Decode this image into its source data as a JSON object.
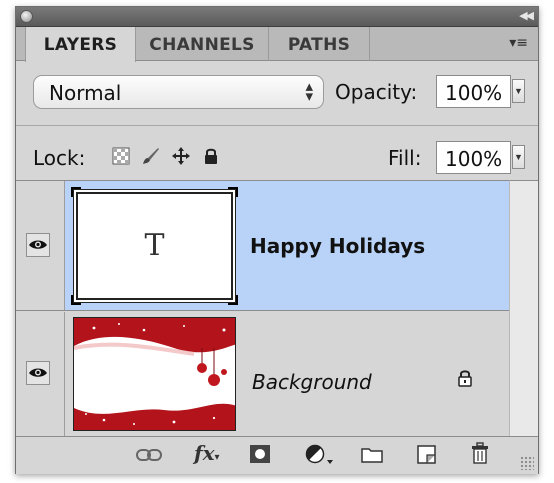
{
  "panel": {
    "tabs": [
      {
        "label": "LAYERS",
        "active": true
      },
      {
        "label": "CHANNELS",
        "active": false
      },
      {
        "label": "PATHS",
        "active": false
      }
    ]
  },
  "controls": {
    "blend_mode": "Normal",
    "opacity_label": "Opacity:",
    "opacity_value": "100%",
    "lock_label": "Lock:",
    "fill_label": "Fill:",
    "fill_value": "100%"
  },
  "layers": [
    {
      "name": "Happy Holidays",
      "thumbnail_glyph": "T",
      "selected": true,
      "visible": true,
      "locked": false
    },
    {
      "name": "Background",
      "selected": false,
      "visible": true,
      "locked": true
    }
  ],
  "colors": {
    "selection": "#b8d3f7",
    "panel_bg": "#d6d6d6",
    "background_red": "#b3141c"
  },
  "icons": {
    "lock_options": [
      "lock-transparent-pixels-icon",
      "lock-image-pixels-icon",
      "lock-position-icon",
      "lock-all-icon"
    ],
    "bottom_bar": [
      "link-layers-icon",
      "layer-style-fx-icon",
      "add-mask-icon",
      "adjustment-layer-icon",
      "new-group-icon",
      "new-layer-icon",
      "delete-layer-icon"
    ]
  }
}
